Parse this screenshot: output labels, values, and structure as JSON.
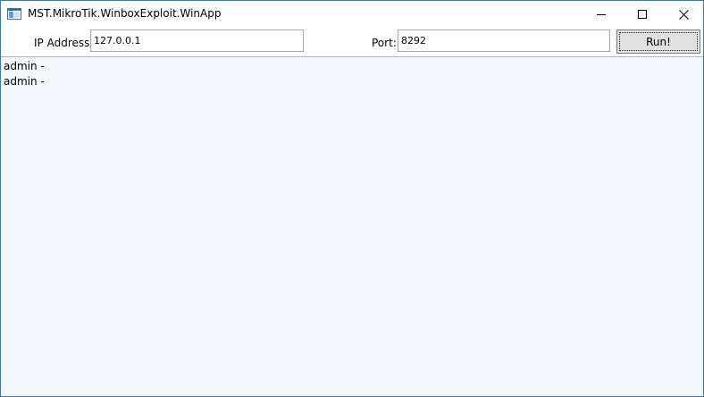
{
  "window": {
    "title": "MST.MikroTik.WinboxExploit.WinApp",
    "icon": "app-window-icon",
    "controls": [
      "minimize-icon",
      "maximize-icon",
      "close-icon"
    ]
  },
  "form": {
    "ip_label": "IP Address:",
    "ip_value": "127.0.0.1",
    "port_label": "Port:",
    "port_value": "8292",
    "run_label": "Run!"
  },
  "output": {
    "lines": [
      "admin -",
      "admin -"
    ]
  },
  "colors": {
    "window_border": "#2b79c2",
    "output_background": "#f3f6fb",
    "button_background": "#e1e1e1"
  }
}
